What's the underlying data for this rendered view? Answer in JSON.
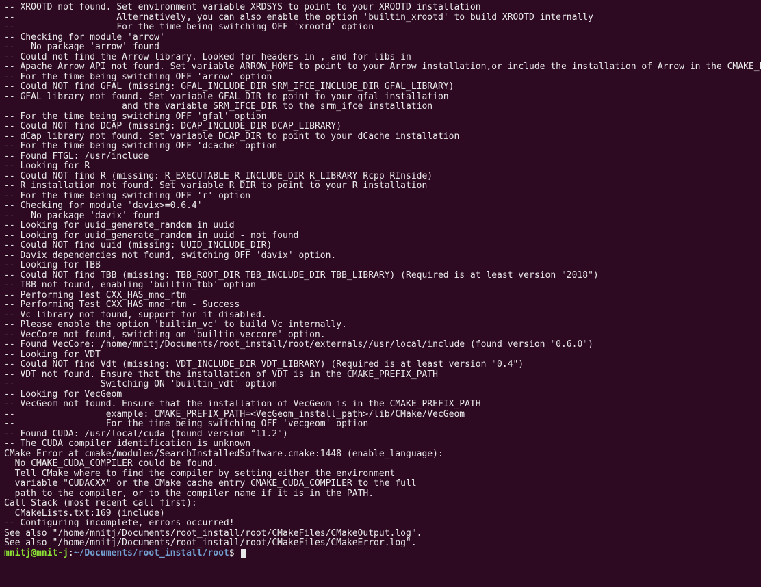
{
  "terminal": {
    "lines": [
      "-- XROOTD not found. Set environment variable XRDSYS to point to your XROOTD installation",
      "--                   Alternatively, you can also enable the option 'builtin_xrootd' to build XROOTD internally",
      "--                   For the time being switching OFF 'xrootd' option",
      "-- Checking for module 'arrow'",
      "--   No package 'arrow' found",
      "-- Could not find the Arrow library. Looked for headers in , and for libs in",
      "-- Apache Arrow API not found. Set variable ARROW_HOME to point to your Arrow installation,or include the installation of Arrow in the CMAKE_PREFIX_PATH.",
      "-- For the time being switching OFF 'arrow' option",
      "-- Could NOT find GFAL (missing: GFAL_INCLUDE_DIR SRM_IFCE_INCLUDE_DIR GFAL_LIBRARY)",
      "-- GFAL library not found. Set variable GFAL_DIR to point to your gfal installation",
      "                      and the variable SRM_IFCE_DIR to the srm_ifce installation",
      "-- For the time being switching OFF 'gfal' option",
      "-- Could NOT find DCAP (missing: DCAP_INCLUDE_DIR DCAP_LIBRARY)",
      "-- dCap library not found. Set variable DCAP_DIR to point to your dCache installation",
      "-- For the time being switching OFF 'dcache' option",
      "-- Found FTGL: /usr/include",
      "-- Looking for R",
      "-- Could NOT find R (missing: R_EXECUTABLE R_INCLUDE_DIR R_LIBRARY Rcpp RInside)",
      "-- R installation not found. Set variable R_DIR to point to your R installation",
      "-- For the time being switching OFF 'r' option",
      "-- Checking for module 'davix>=0.6.4'",
      "--   No package 'davix' found",
      "-- Looking for uuid_generate_random in uuid",
      "-- Looking for uuid_generate_random in uuid - not found",
      "-- Could NOT find uuid (missing: UUID_INCLUDE_DIR)",
      "-- Davix dependencies not found, switching OFF 'davix' option.",
      "-- Looking for TBB",
      "-- Could NOT find TBB (missing: TBB_ROOT_DIR TBB_INCLUDE_DIR TBB_LIBRARY) (Required is at least version \"2018\")",
      "-- TBB not found, enabling 'builtin_tbb' option",
      "-- Performing Test CXX_HAS_mno_rtm",
      "-- Performing Test CXX_HAS_mno_rtm - Success",
      "-- Vc library not found, support for it disabled.",
      "-- Please enable the option 'builtin_vc' to build Vc internally.",
      "-- VecCore not found, switching on 'builtin_veccore' option.",
      "-- Found VecCore: /home/mnitj/Documents/root_install/root/externals//usr/local/include (found version \"0.6.0\")",
      "-- Looking for VDT",
      "-- Could NOT find Vdt (missing: VDT_INCLUDE_DIR VDT_LIBRARY) (Required is at least version \"0.4\")",
      "-- VDT not found. Ensure that the installation of VDT is in the CMAKE_PREFIX_PATH",
      "--                Switching ON 'builtin_vdt' option",
      "-- Looking for VecGeom",
      "-- VecGeom not found. Ensure that the installation of VecGeom is in the CMAKE_PREFIX_PATH",
      "--                 example: CMAKE_PREFIX_PATH=<VecGeom_install_path>/lib/CMake/VecGeom",
      "--                 For the time being switching OFF 'vecgeom' option",
      "-- Found CUDA: /usr/local/cuda (found version \"11.2\")",
      "-- The CUDA compiler identification is unknown",
      "CMake Error at cmake/modules/SearchInstalledSoftware.cmake:1448 (enable_language):",
      "  No CMAKE_CUDA_COMPILER could be found.",
      "",
      "  Tell CMake where to find the compiler by setting either the environment",
      "  variable \"CUDACXX\" or the CMake cache entry CMAKE_CUDA_COMPILER to the full",
      "  path to the compiler, or to the compiler name if it is in the PATH.",
      "Call Stack (most recent call first):",
      "  CMakeLists.txt:169 (include)",
      "",
      "",
      "-- Configuring incomplete, errors occurred!",
      "See also \"/home/mnitj/Documents/root_install/root/CMakeFiles/CMakeOutput.log\".",
      "See also \"/home/mnitj/Documents/root_install/root/CMakeFiles/CMakeError.log\"."
    ],
    "prompt": {
      "user_host": "mnitj@mnit-j",
      "sep": ":",
      "path": "~/Documents/root_install/root",
      "dollar": "$ "
    }
  }
}
